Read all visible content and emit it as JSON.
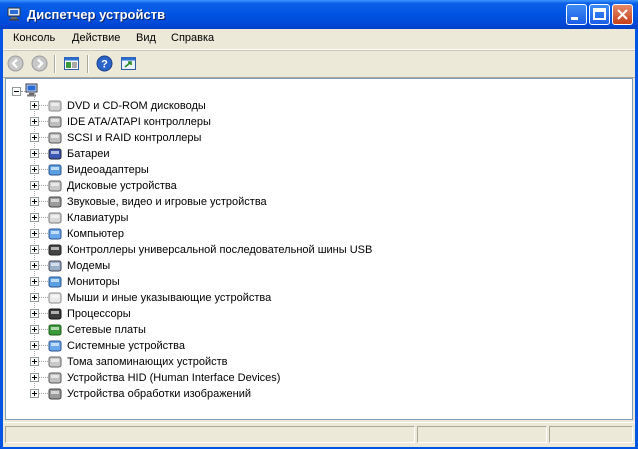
{
  "window": {
    "title": "Диспетчер устройств",
    "icon": "device-manager-icon"
  },
  "menu": [
    "Консоль",
    "Действие",
    "Вид",
    "Справка"
  ],
  "toolbar": [
    {
      "icon": "back-arrow-icon"
    },
    {
      "icon": "forward-arrow-icon"
    },
    {
      "icon": "properties-icon"
    },
    {
      "icon": "help-icon"
    },
    {
      "icon": "refresh-icon"
    }
  ],
  "tree": {
    "root_icon": "computer-icon",
    "items": [
      {
        "label": "DVD и CD-ROM дисководы",
        "icon": "cdrom-icon"
      },
      {
        "label": "IDE ATA/ATAPI контроллеры",
        "icon": "ide-controller-icon"
      },
      {
        "label": "SCSI и RAID контроллеры",
        "icon": "scsi-controller-icon"
      },
      {
        "label": "Батареи",
        "icon": "battery-icon"
      },
      {
        "label": "Видеоадаптеры",
        "icon": "display-adapter-icon"
      },
      {
        "label": "Дисковые устройства",
        "icon": "disk-drive-icon"
      },
      {
        "label": "Звуковые, видео и игровые устройства",
        "icon": "sound-icon"
      },
      {
        "label": "Клавиатуры",
        "icon": "keyboard-icon"
      },
      {
        "label": "Компьютер",
        "icon": "computer-icon"
      },
      {
        "label": "Контроллеры универсальной последовательной шины USB",
        "icon": "usb-icon"
      },
      {
        "label": "Модемы",
        "icon": "modem-icon"
      },
      {
        "label": "Мониторы",
        "icon": "monitor-icon"
      },
      {
        "label": "Мыши и иные указывающие устройства",
        "icon": "mouse-icon"
      },
      {
        "label": "Процессоры",
        "icon": "processor-icon"
      },
      {
        "label": "Сетевые платы",
        "icon": "network-adapter-icon"
      },
      {
        "label": "Системные устройства",
        "icon": "system-device-icon"
      },
      {
        "label": "Тома запоминающих устройств",
        "icon": "storage-volume-icon"
      },
      {
        "label": "Устройства HID (Human Interface Devices)",
        "icon": "hid-icon"
      },
      {
        "label": "Устройства обработки изображений",
        "icon": "imaging-icon"
      }
    ]
  }
}
